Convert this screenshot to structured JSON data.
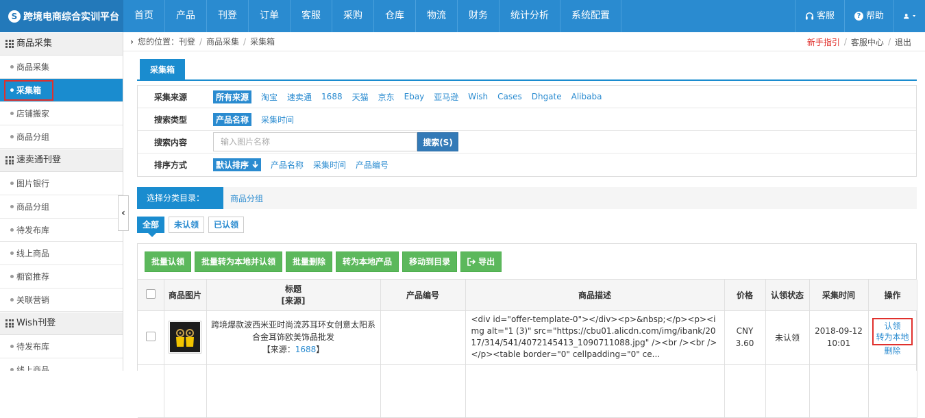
{
  "app": {
    "title": "跨境电商综合实训平台",
    "logo_letter": "S"
  },
  "nav": [
    "首页",
    "产品",
    "刊登",
    "订单",
    "客服",
    "采购",
    "仓库",
    "物流",
    "财务",
    "统计分析",
    "系统配置"
  ],
  "top_right": {
    "service": "客服",
    "help": "帮助",
    "user_icon": "user-icon"
  },
  "sidebar": {
    "groups": [
      {
        "label": "商品采集",
        "items": [
          "商品采集",
          "采集箱",
          "店铺搬家",
          "商品分组"
        ]
      },
      {
        "label": "速卖通刊登",
        "items": [
          "图片银行",
          "商品分组",
          "待发布库",
          "线上商品",
          "橱窗推荐",
          "关联营销"
        ]
      },
      {
        "label": "Wish刊登",
        "items": [
          "待发布库",
          "线上商品"
        ]
      }
    ],
    "active_item": "采集箱"
  },
  "breadcrumb": {
    "prefix": "您的位置：",
    "items": [
      "刊登",
      "商品采集",
      "采集箱"
    ],
    "links": [
      "新手指引",
      "客服中心",
      "退出"
    ]
  },
  "tab": "采集箱",
  "filters": {
    "source": {
      "label": "采集来源",
      "options": [
        "所有来源",
        "淘宝",
        "速卖通",
        "1688",
        "天猫",
        "京东",
        "Ebay",
        "亚马逊",
        "Wish",
        "Cases",
        "Dhgate",
        "Alibaba"
      ],
      "selected": "所有来源"
    },
    "search_type": {
      "label": "搜索类型",
      "options": [
        "产品名称",
        "采集时间"
      ],
      "selected": "产品名称"
    },
    "search_content": {
      "label": "搜索内容",
      "placeholder": "输入图片名称",
      "button": "搜索(S)"
    },
    "sort": {
      "label": "排序方式",
      "options": [
        "默认排序",
        "产品名称",
        "采集时间",
        "产品编号"
      ],
      "selected": "默认排序"
    }
  },
  "category": {
    "label": "选择分类目录：",
    "link": "商品分组"
  },
  "status_tabs": [
    "全部",
    "未认领",
    "已认领"
  ],
  "toolbar": [
    "批量认领",
    "批量转为本地并认领",
    "批量删除",
    "转为本地产品",
    "移动到目录",
    "导出"
  ],
  "columns": [
    "商品图片",
    "标题",
    "[来源]",
    "产品编号",
    "商品描述",
    "价格",
    "认领状态",
    "采集时间",
    "操作"
  ],
  "rows": [
    {
      "title": "跨境爆款波西米亚时尚流苏耳环女创意太阳系合金耳饰欧美饰品批发",
      "source_prefix": "【来源：",
      "source": "1688",
      "source_suffix": "】",
      "product_no": "",
      "description": "<div id=\"offer-template-0\"></div><p>&nbsp;</p><p><img alt=\"1 (3)\" src=\"https://cbu01.alicdn.com/img/ibank/2017/314/541/4072145413_1090711088.jpg\" /><br /><br /></p><table border=\"0\" cellpadding=\"0\" ce...",
      "currency": "CNY",
      "price": "3.60",
      "status": "未认领",
      "date": "2018-09-12",
      "time": "10:01",
      "actions": [
        "认领",
        "转为本地",
        "删除"
      ]
    }
  ]
}
